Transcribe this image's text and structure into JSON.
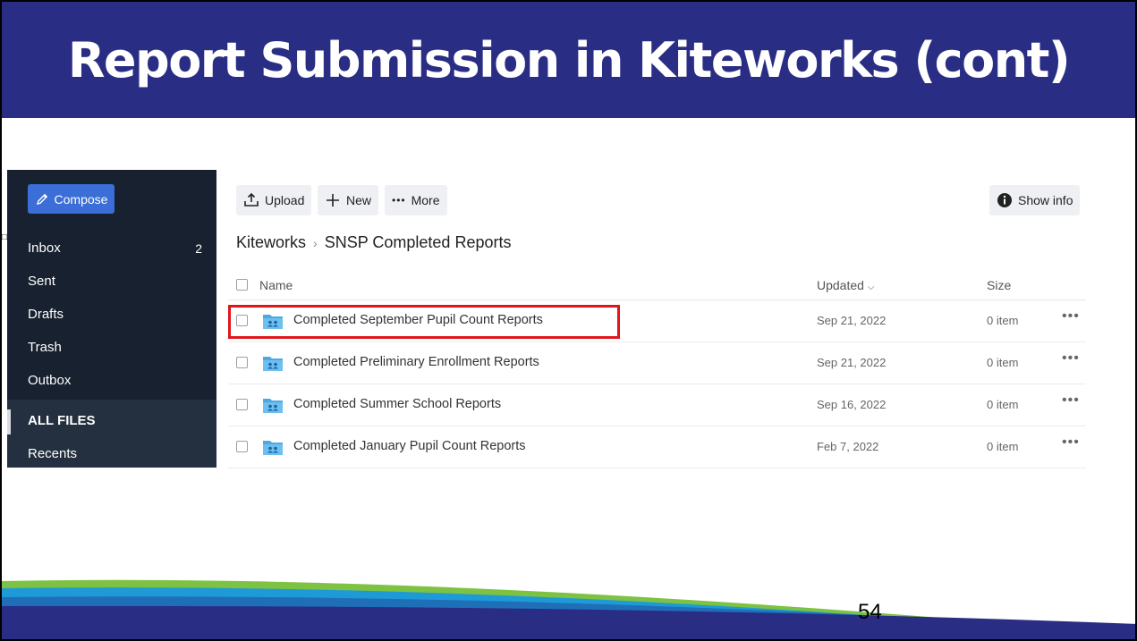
{
  "slide": {
    "title": "Report Submission in Kiteworks (cont)",
    "page_number": "54",
    "title_bg": "#2a2d84"
  },
  "sidebar": {
    "compose_label": "Compose",
    "items": [
      {
        "label": "Inbox",
        "badge": "2"
      },
      {
        "label": "Sent"
      },
      {
        "label": "Drafts"
      },
      {
        "label": "Trash"
      },
      {
        "label": "Outbox"
      },
      {
        "label": "ALL FILES"
      },
      {
        "label": "Recents"
      }
    ],
    "active_item": "ALL FILES",
    "accent": "#3b6ed6"
  },
  "toolbar": {
    "upload_label": "Upload",
    "new_label": "New",
    "more_label": "More",
    "show_info_label": "Show info"
  },
  "breadcrumb": {
    "root": "Kiteworks",
    "current": "SNSP Completed Reports"
  },
  "table": {
    "headers": {
      "name": "Name",
      "updated": "Updated",
      "size": "Size"
    },
    "rows": [
      {
        "name": "Completed September Pupil Count Reports",
        "updated": "Sep 21, 2022",
        "size": "0 item",
        "highlighted": true
      },
      {
        "name": "Completed Preliminary Enrollment Reports",
        "updated": "Sep 21, 2022",
        "size": "0 item"
      },
      {
        "name": "Completed Summer School Reports",
        "updated": "Sep 16, 2022",
        "size": "0 item"
      },
      {
        "name": "Completed January Pupil Count Reports",
        "updated": "Feb 7, 2022",
        "size": "0 item"
      }
    ],
    "row_more_icon": "ellipsis-icon",
    "folder_icon": "shared-folder-icon",
    "highlight_color": "#e0161b"
  }
}
